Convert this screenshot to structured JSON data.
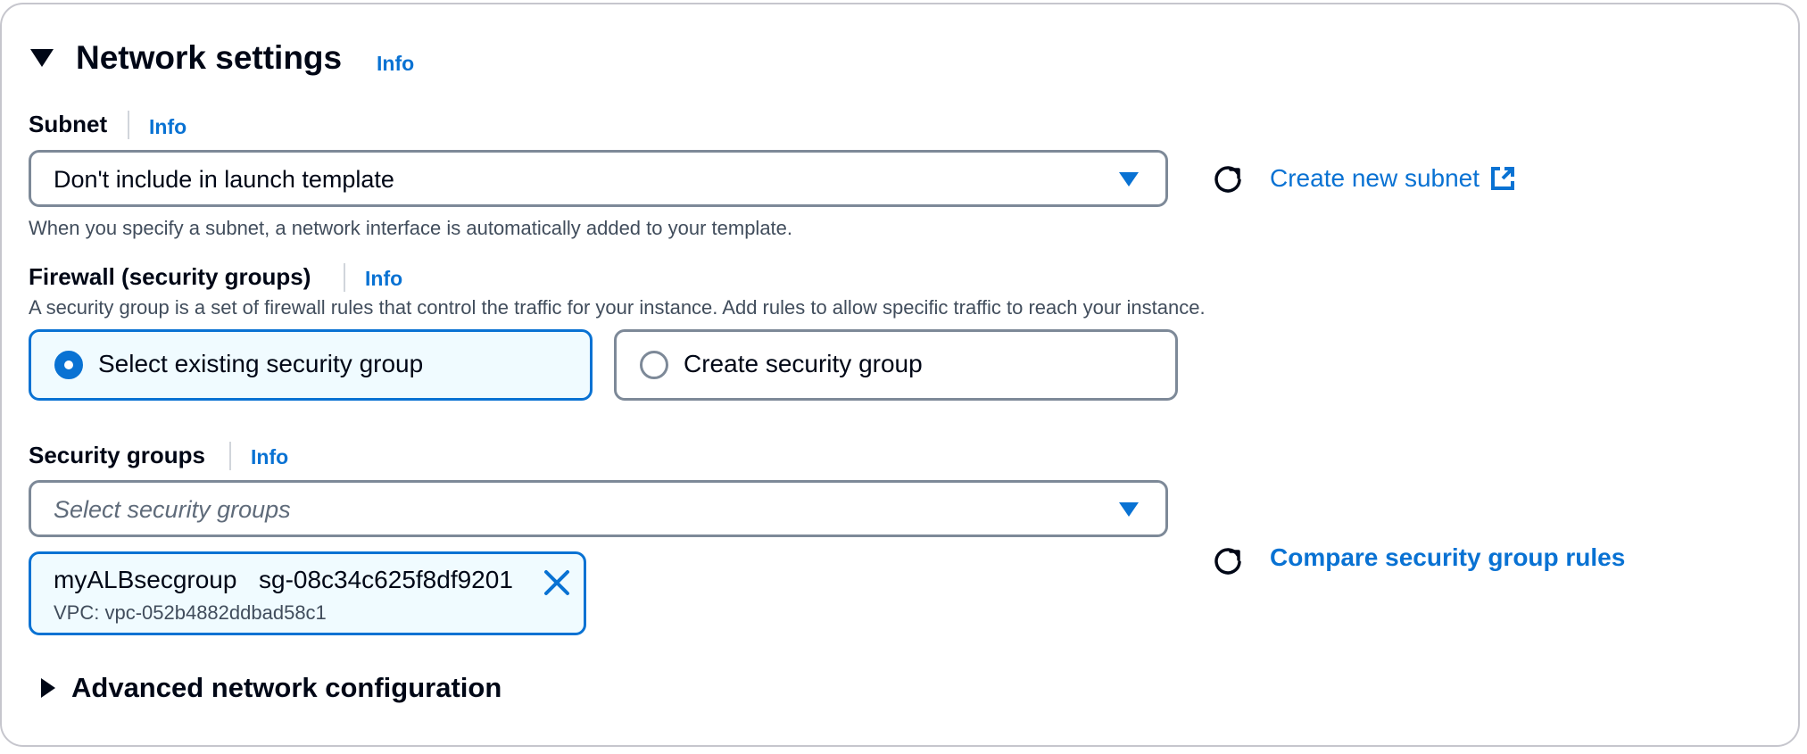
{
  "section": {
    "title": "Network settings",
    "info": "Info"
  },
  "subnet": {
    "label": "Subnet",
    "info": "Info",
    "selected_value": "Don't include in launch template",
    "description": "When you specify a subnet, a network interface is automatically added to your template.",
    "create_link": "Create new subnet"
  },
  "firewall": {
    "label": "Firewall (security groups)",
    "info": "Info",
    "description": "A security group is a set of firewall rules that control the traffic for your instance. Add rules to allow specific traffic to reach your instance.",
    "options": [
      {
        "label": "Select existing security group",
        "selected": true
      },
      {
        "label": "Create security group",
        "selected": false
      }
    ]
  },
  "security_groups": {
    "label": "Security groups",
    "info": "Info",
    "placeholder": "Select security groups",
    "compare_link": "Compare security group rules",
    "selected_tokens": [
      {
        "name": "myALBsecgroup",
        "id": "sg-08c34c625f8df9201",
        "vpc": "VPC: vpc-052b4882ddbad58c1"
      }
    ]
  },
  "advanced": {
    "title": "Advanced network configuration"
  },
  "colors": {
    "link": "#0972d3",
    "text": "#000716",
    "secondary_text": "#414d5c",
    "border": "#7d8998",
    "selected_bg": "#f0fbff"
  },
  "icons": [
    "caret-down-icon",
    "dropdown-arrow-icon",
    "refresh-icon",
    "external-link-icon",
    "radio-selected-icon",
    "radio-unselected-icon",
    "remove-x-icon",
    "caret-right-icon"
  ]
}
